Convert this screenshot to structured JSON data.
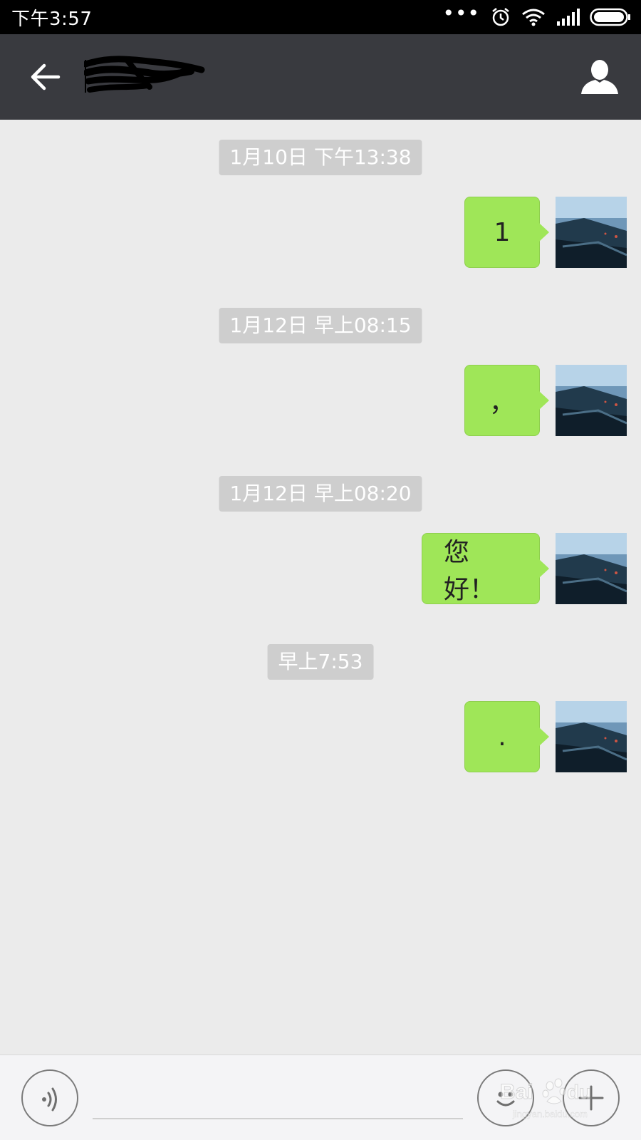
{
  "status_bar": {
    "time": "下午3:57",
    "dots": "•••"
  },
  "header": {
    "back_icon": "arrow-left-icon",
    "contact_name": "",
    "contact_icon": "person-icon"
  },
  "messages": [
    {
      "timestamp": "1月10日 下午13:38",
      "text": "1",
      "sender": "self"
    },
    {
      "timestamp": "1月12日 早上08:15",
      "text": "，",
      "sender": "self"
    },
    {
      "timestamp": "1月12日 早上08:20",
      "text": "您好！",
      "sender": "self"
    },
    {
      "timestamp": "早上7:53",
      "text": ".",
      "sender": "self"
    }
  ],
  "input_bar": {
    "text_value": "",
    "voice_icon": "voice-icon",
    "emoji_icon": "emoji-icon",
    "plus_icon": "plus-icon"
  },
  "watermark": {
    "text": "Bai du 经验",
    "url_text": "jingyan.baidu.com"
  },
  "colors": {
    "bubble_green": "#9fe658",
    "header_bg": "#393a3f",
    "chat_bg": "#ebebeb",
    "timestamp_bg": "#cecece"
  }
}
